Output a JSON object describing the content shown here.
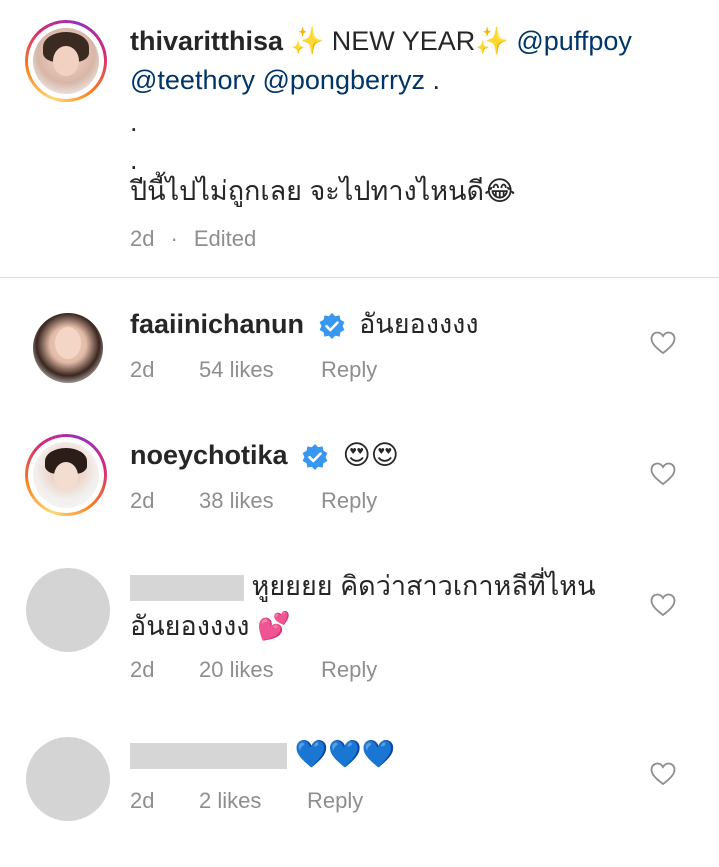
{
  "caption": {
    "username": "thivaritthisa",
    "sparkle_left": "✨",
    "headline": " NEW YEAR",
    "sparkle_right": "✨",
    "mention1": "@puffpoy",
    "mention2": "@teethory",
    "mention3": "@pongberryz",
    "after_mentions": " .",
    "dot1": ".",
    "dot2": ".",
    "thai_line": "ปีนี้ไปไม่ถูกเลย จะไปทางไหนดี",
    "thai_emoji": "😂",
    "time": "2d",
    "sep": "·",
    "edited": "Edited"
  },
  "comments": [
    {
      "username": "faaiinichanun",
      "text": "อันยองงงง",
      "time": "2d",
      "likes": "54 likes",
      "reply": "Reply"
    },
    {
      "username": "noeychotika",
      "text": "😍😍",
      "time": "2d",
      "likes": "38 likes",
      "reply": "Reply"
    },
    {
      "text_line1": "หูยยยย คิดว่าสาวเกาหลีที่ไหน",
      "text_line2": "อันยองงงง",
      "emoji": "💕",
      "time": "2d",
      "likes": "20 likes",
      "reply": "Reply"
    },
    {
      "text": "💙💙💙",
      "time": "2d",
      "likes": "2 likes",
      "reply": "Reply"
    }
  ],
  "colors": {
    "verified": "#3897f0",
    "heart_blue": "#1e88e5",
    "text_gray": "#8e8e8e"
  },
  "icons": {
    "like": "heart-outline-icon",
    "verified": "verified-badge-icon"
  }
}
